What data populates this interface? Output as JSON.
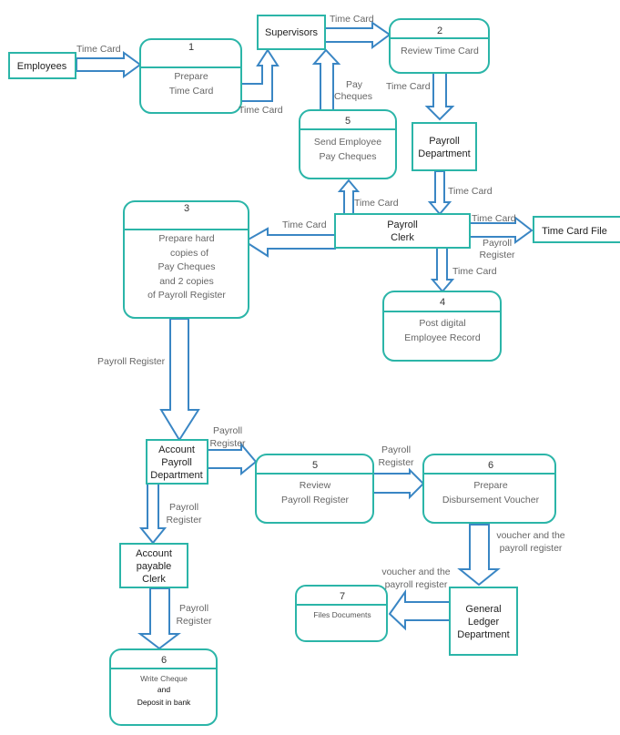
{
  "colors": {
    "node_border": "#2bb5a8",
    "arrow_stroke": "#3a86c4",
    "label_text": "#666666",
    "entity_text": "#222222"
  },
  "entities": {
    "employees": "Employees",
    "supervisors": "Supervisors",
    "payroll_department": [
      "Payroll",
      "Department"
    ],
    "payroll_clerk": [
      "Payroll",
      "Clerk"
    ],
    "time_card_file": "Time Card File",
    "account_payroll_department": [
      "Account",
      "Payroll",
      "Department"
    ],
    "account_payable_clerk": [
      "Account",
      "payable",
      "Clerk"
    ],
    "general_ledger_department": [
      "General",
      "Ledger",
      "Department"
    ]
  },
  "processes": {
    "p1": {
      "number": "1",
      "lines": [
        "Prepare",
        "Time Card"
      ]
    },
    "p2": {
      "number": "2",
      "lines": [
        "Review Time Card"
      ]
    },
    "p5a": {
      "number": "5",
      "lines": [
        "Send Employee",
        "Pay Cheques"
      ]
    },
    "p3": {
      "number": "3",
      "lines": [
        "Prepare hard",
        "copies of",
        "Pay Cheques",
        "and 2 copies",
        "of Payroll Register"
      ]
    },
    "p4": {
      "number": "4",
      "lines": [
        "Post digital",
        "Employee Record"
      ]
    },
    "p5b": {
      "number": "5",
      "lines": [
        "Review",
        "Payroll Register"
      ]
    },
    "p6a": {
      "number": "6",
      "lines": [
        "Prepare",
        "Disbursement Voucher"
      ]
    },
    "p7": {
      "number": "7",
      "lines": [
        "Files Documents"
      ]
    },
    "p6b": {
      "number": "6",
      "lines": [
        "Write Cheque",
        "and",
        "Deposit in bank"
      ]
    }
  },
  "flows": {
    "emp_to_p1": "Time Card",
    "p1_to_sup": "Time Card",
    "sup_to_p2": "Time Card",
    "p2_to_paydept": "Time Card",
    "p5a_to_sup": [
      "Pay",
      "Cheques"
    ],
    "paydept_to_clerk": "Time Card",
    "clerk_to_p5a": "Time Card",
    "clerk_to_p3": "Time Card",
    "clerk_to_file_1": "Time Card",
    "clerk_to_file_2": [
      "Payroll",
      "Register"
    ],
    "clerk_to_p4": "Time Card",
    "p3_to_apd": "Payroll Register",
    "apd_to_p5b": [
      "Payroll",
      "Register"
    ],
    "p5b_to_p6a": [
      "Payroll",
      "Register"
    ],
    "apd_to_apc": [
      "Payroll",
      "Register"
    ],
    "p6a_to_gl": [
      "voucher and the",
      "payroll register"
    ],
    "gl_to_p7": [
      "voucher and the",
      "payroll register"
    ],
    "apc_to_p6b": [
      "Payroll",
      "Register"
    ]
  }
}
